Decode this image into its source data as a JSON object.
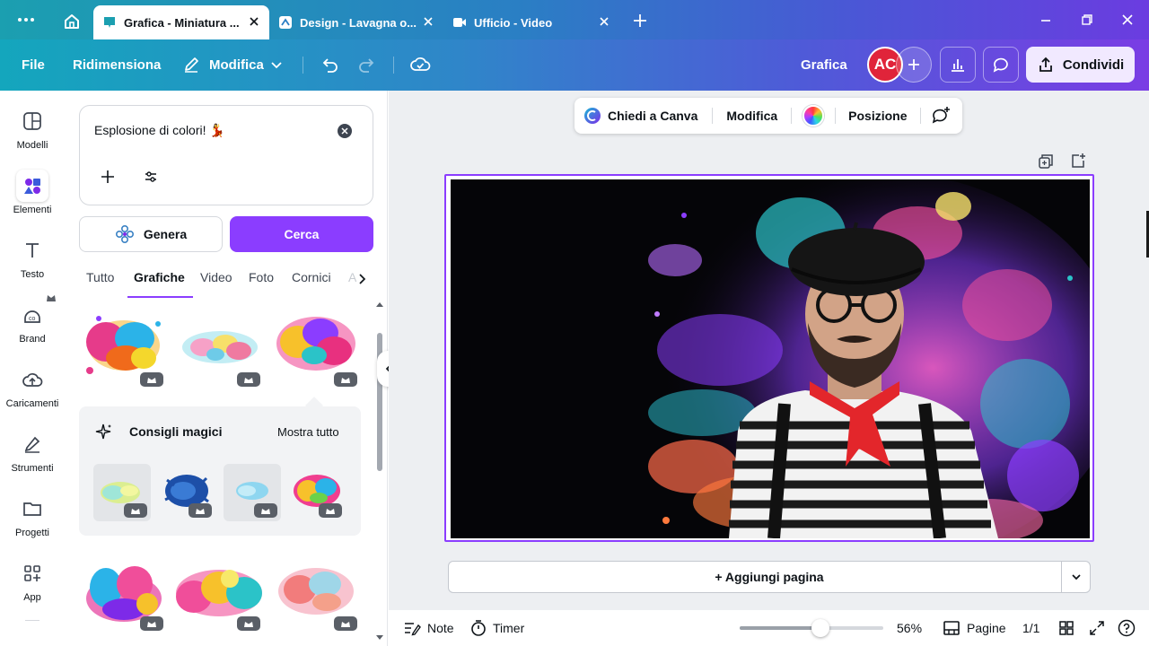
{
  "browser": {
    "tabs": [
      {
        "label": "Grafica - Miniatura ..."
      },
      {
        "label": "Design - Lavagna o..."
      },
      {
        "label": "Ufficio - Video"
      }
    ]
  },
  "toolbar": {
    "file": "File",
    "resize": "Ridimensiona",
    "edit": "Modifica",
    "doc_type": "Grafica",
    "avatar": "AC",
    "share": "Condividi"
  },
  "rail": {
    "items": [
      {
        "label": "Modelli"
      },
      {
        "label": "Elementi"
      },
      {
        "label": "Testo"
      },
      {
        "label": "Brand"
      },
      {
        "label": "Caricamenti"
      },
      {
        "label": "Strumenti"
      },
      {
        "label": "Progetti"
      },
      {
        "label": "App"
      }
    ]
  },
  "panel": {
    "search_value": "Esplosione di colori! 💃",
    "generate": "Genera",
    "search": "Cerca",
    "filters": [
      "Tutto",
      "Grafiche",
      "Video",
      "Foto",
      "Cornici",
      "A"
    ],
    "active_filter": "Grafiche",
    "magic_title": "Consigli magici",
    "show_all": "Mostra tutto"
  },
  "floatbar": {
    "ask": "Chiedi a Canva",
    "edit": "Modifica",
    "position": "Posizione"
  },
  "canvas": {
    "add_page": "+ Aggiungi pagina"
  },
  "bottombar": {
    "notes": "Note",
    "timer": "Timer",
    "zoom": "56%",
    "zoom_fraction": 0.56,
    "pages": "Pagine",
    "page_count": "1/1"
  },
  "colors": {
    "accent": "#8b3dff",
    "avatar_bg": "#e0243a",
    "share_bg": "#f1e9ff"
  }
}
